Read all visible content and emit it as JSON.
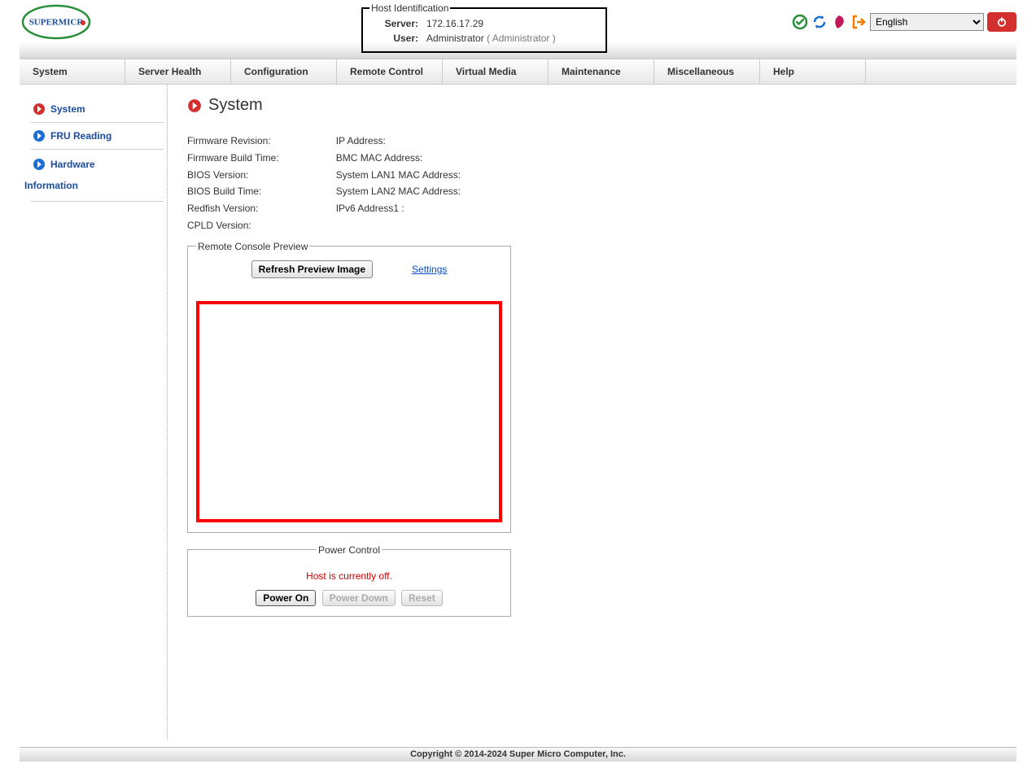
{
  "header": {
    "host_id_legend": "Host Identification",
    "server_label": "Server:",
    "server_value": "172.16.17.29",
    "user_label": "User:",
    "user_value": "Administrator",
    "user_role": "( Administrator )",
    "language_selected": "English",
    "languages": [
      "English"
    ]
  },
  "menu": {
    "items": [
      "System",
      "Server Health",
      "Configuration",
      "Remote Control",
      "Virtual Media",
      "Maintenance",
      "Miscellaneous",
      "Help"
    ]
  },
  "sidebar": {
    "items": [
      {
        "label": "System",
        "active": true
      },
      {
        "label": "FRU Reading",
        "active": false
      },
      {
        "label": "Hardware",
        "label2": "Information",
        "active": false
      }
    ]
  },
  "page": {
    "title": "System"
  },
  "info": {
    "left": [
      "Firmware Revision:",
      "Firmware Build Time:",
      "BIOS Version:",
      "BIOS Build Time:",
      "Redfish Version:",
      "CPLD Version:"
    ],
    "right": [
      "IP Address:",
      "BMC MAC Address:",
      "System LAN1 MAC Address:",
      "System LAN2 MAC Address:",
      "IPv6 Address1 :"
    ]
  },
  "console": {
    "legend": "Remote Console Preview",
    "refresh_label": "Refresh Preview Image",
    "settings_label": "Settings"
  },
  "power": {
    "legend": "Power Control",
    "status": "Host is currently off.",
    "power_on": "Power On",
    "power_down": "Power Down",
    "reset": "Reset"
  },
  "footer": {
    "text": "Copyright © 2014-2024 Super Micro Computer, Inc."
  }
}
